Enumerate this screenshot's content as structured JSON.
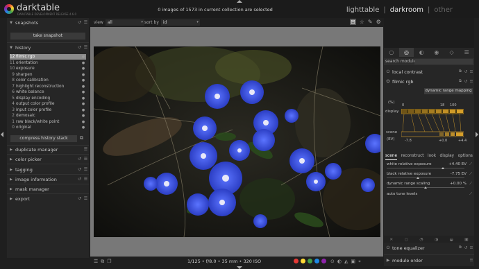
{
  "app": {
    "name": "darktable",
    "subtitle": "DARKTABLE DEVELOPMENT RELEASE 4.6.0"
  },
  "header": {
    "selection_info": "0 images of 1573 in current collection are selected",
    "views": [
      "lighttable",
      "|",
      "darkroom",
      "|",
      "other"
    ]
  },
  "left_panel": {
    "snapshots": {
      "label": "snapshots",
      "take_label": "take snapshot"
    },
    "history": {
      "label": "history",
      "items": [
        {
          "num": "12",
          "name": "filmic rgb",
          "state": "●"
        },
        {
          "num": "11",
          "name": "orientation",
          "state": "●"
        },
        {
          "num": "10",
          "name": "exposure",
          "state": "●"
        },
        {
          "num": "9",
          "name": "sharpen",
          "state": "●"
        },
        {
          "num": "8",
          "name": "color calibration",
          "state": "●"
        },
        {
          "num": "7",
          "name": "highlight reconstruction",
          "state": "●"
        },
        {
          "num": "6",
          "name": "white balance",
          "state": "●"
        },
        {
          "num": "5",
          "name": "display encoding",
          "state": "●"
        },
        {
          "num": "4",
          "name": "output color profile",
          "state": "●"
        },
        {
          "num": "3",
          "name": "input color profile",
          "state": "●"
        },
        {
          "num": "2",
          "name": "demosaic",
          "state": "●"
        },
        {
          "num": "1",
          "name": "raw black/white point",
          "state": "●"
        },
        {
          "num": "0",
          "name": "original",
          "state": "●"
        }
      ],
      "compress_label": "compress history stack"
    },
    "modules": [
      "duplicate manager",
      "color picker",
      "tagging",
      "image information",
      "mask manager",
      "export"
    ]
  },
  "toolbar": {
    "view_label": "view",
    "view_value": "all",
    "sort_label": "sort by",
    "sort_value": "id"
  },
  "bottom": {
    "exif": "1/125 • f/8.0 • 35 mm • 320 ISO",
    "left_icons": [
      "☰",
      "⧉",
      "❐"
    ],
    "dot_colors": [
      "#e53935",
      "#fdd835",
      "#43a047",
      "#1e88e5",
      "#8e24aa",
      "#9e9e9e"
    ],
    "right_icons": [
      "⊙",
      "◐",
      "◭",
      "▣",
      "⌖"
    ]
  },
  "right_panel": {
    "tabs": [
      "○",
      "◎",
      "◐",
      "◉",
      "◇",
      "☰"
    ],
    "search_label": "search module",
    "local_contrast": "local contrast",
    "filmic": {
      "label": "filmic rgb",
      "mapping_button": "dynamic range mapping",
      "graph": {
        "pct_label": "(%)",
        "display_label": "display",
        "scene_label": "scene",
        "ev_label": "(EV)",
        "top_ticks": [
          "0",
          "18",
          "100"
        ],
        "bottom_ticks": [
          "-7.8",
          "+0.0",
          "+4.4"
        ]
      },
      "subtabs": [
        "scene",
        "reconstruct",
        "look",
        "display",
        "options"
      ],
      "sliders": [
        {
          "label": "white relative exposure",
          "value": "+4.40 EV",
          "level": 0.72
        },
        {
          "label": "black relative exposure",
          "value": "-7.75 EV",
          "level": 0.4
        },
        {
          "label": "dynamic range scaling",
          "value": "+0.00 %",
          "level": 0.5
        }
      ],
      "auto_tune": "auto tune levels"
    },
    "tone_equalizer": "tone equalizer",
    "module_order": "module order",
    "blend_icons": [
      "✕",
      "○",
      "◔",
      "◑",
      "◒",
      "▣"
    ]
  },
  "colors": {
    "accent": "#8a8a8a",
    "flower": "#2f4fe0",
    "graph_orange": "#d69f2a"
  }
}
